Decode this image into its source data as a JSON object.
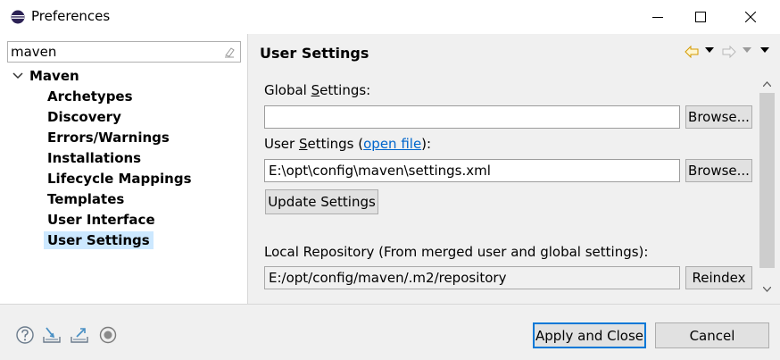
{
  "window": {
    "title": "Preferences"
  },
  "filter": {
    "value": "maven"
  },
  "tree": {
    "root_label": "Maven",
    "children": [
      "Archetypes",
      "Discovery",
      "Errors/Warnings",
      "Installations",
      "Lifecycle Mappings",
      "Templates",
      "User Interface",
      "User Settings"
    ],
    "selected": "User Settings"
  },
  "page": {
    "title": "User Settings",
    "global_settings_label_pre": "Global ",
    "global_settings_label_u": "S",
    "global_settings_label_post": "ettings:",
    "global_settings_value": "",
    "browse_label": "Browse...",
    "user_settings_label_pre": "User ",
    "user_settings_label_u": "S",
    "user_settings_label_post": "ettings (",
    "open_file_link": "open file",
    "user_settings_label_end": "):",
    "user_settings_value": "E:\\opt\\config\\maven\\settings.xml",
    "update_settings_label": "Update Settings",
    "local_repo_label": "Local Repository (From merged user and global settings):",
    "local_repo_value": "E:/opt/config/maven/.m2/repository",
    "reindex_label": "Reindex"
  },
  "footer": {
    "apply_close_label": "Apply and Close",
    "cancel_label": "Cancel"
  },
  "colors": {
    "selection": "#cce8ff",
    "primary_border": "#0078d7",
    "link": "#0066cc",
    "nav_arrow": "#e0a000"
  }
}
